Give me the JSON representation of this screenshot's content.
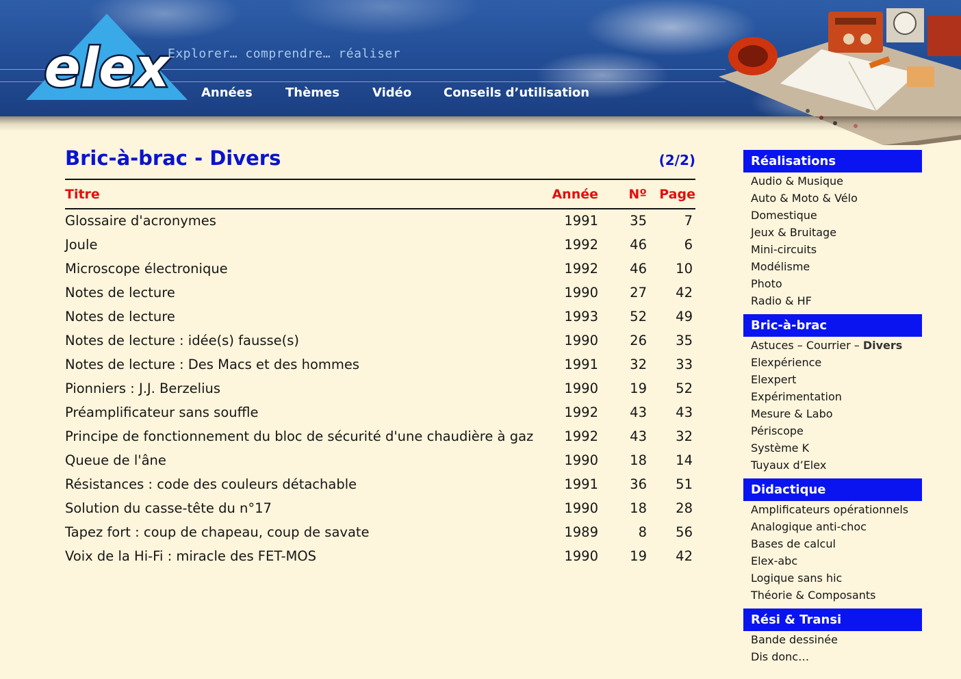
{
  "header": {
    "logo_text": "elex",
    "tagline": "Explorer… comprendre… réaliser",
    "nav": [
      "Années",
      "Thèmes",
      "Vidéo",
      "Conseils d’utilisation"
    ]
  },
  "main": {
    "title": "Bric-à-brac - Divers",
    "page_count": "(2/2)",
    "columns": {
      "title": "Titre",
      "year": "Année",
      "no": "Nº",
      "page": "Page"
    },
    "rows": [
      {
        "title": "Glossaire d'acronymes",
        "year": "1991",
        "no": "35",
        "page": "7"
      },
      {
        "title": "Joule",
        "year": "1992",
        "no": "46",
        "page": "6"
      },
      {
        "title": "Microscope électronique",
        "year": "1992",
        "no": "46",
        "page": "10"
      },
      {
        "title": "Notes de lecture",
        "year": "1990",
        "no": "27",
        "page": "42"
      },
      {
        "title": "Notes de lecture",
        "year": "1993",
        "no": "52",
        "page": "49"
      },
      {
        "title": "Notes de lecture : idée(s) fausse(s)",
        "year": "1990",
        "no": "26",
        "page": "35"
      },
      {
        "title": "Notes de lecture : Des Macs et des hommes",
        "year": "1991",
        "no": "32",
        "page": "33"
      },
      {
        "title": "Pionniers : J.J. Berzelius",
        "year": "1990",
        "no": "19",
        "page": "52"
      },
      {
        "title": "Préamplificateur sans souffle",
        "year": "1992",
        "no": "43",
        "page": "43"
      },
      {
        "title": "Principe de fonctionnement du bloc de sécurité d'une chaudière à gaz",
        "year": "1992",
        "no": "43",
        "page": "32"
      },
      {
        "title": "Queue de l'âne",
        "year": "1990",
        "no": "18",
        "page": "14"
      },
      {
        "title": "Résistances : code des couleurs détachable",
        "year": "1991",
        "no": "36",
        "page": "51"
      },
      {
        "title": "Solution du casse-tête du n°17",
        "year": "1990",
        "no": "18",
        "page": "28"
      },
      {
        "title": "Tapez fort : coup de chapeau, coup de savate",
        "year": "1989",
        "no": "8",
        "page": "56"
      },
      {
        "title": "Voix de la Hi-Fi : miracle des FET-MOS",
        "year": "1990",
        "no": "19",
        "page": "42"
      }
    ]
  },
  "sidebar": {
    "sections": [
      {
        "heading": "Réalisations",
        "items": [
          "Audio & Musique",
          "Auto & Moto & Vélo",
          "Domestique",
          "Jeux & Bruitage",
          "Mini-circuits",
          "Modélisme",
          "Photo",
          "Radio & HF"
        ]
      },
      {
        "heading": "Bric-à-brac",
        "items": [
          "Astuces – Courrier – ",
          "Elexpérience",
          "Elexpert",
          "Expérimentation",
          "Mesure & Labo",
          "Périscope",
          "Système K",
          "Tuyaux d’Elex"
        ],
        "current": "Divers"
      },
      {
        "heading": "Didactique",
        "items": [
          "Amplificateurs opérationnels",
          "Analogique anti-choc",
          "Bases de calcul",
          "Elex-abc",
          "Logique sans hic",
          "Théorie & Composants"
        ]
      },
      {
        "heading": "Rési & Transi",
        "items": [
          "Bande dessinée",
          "Dis donc…"
        ]
      }
    ]
  }
}
